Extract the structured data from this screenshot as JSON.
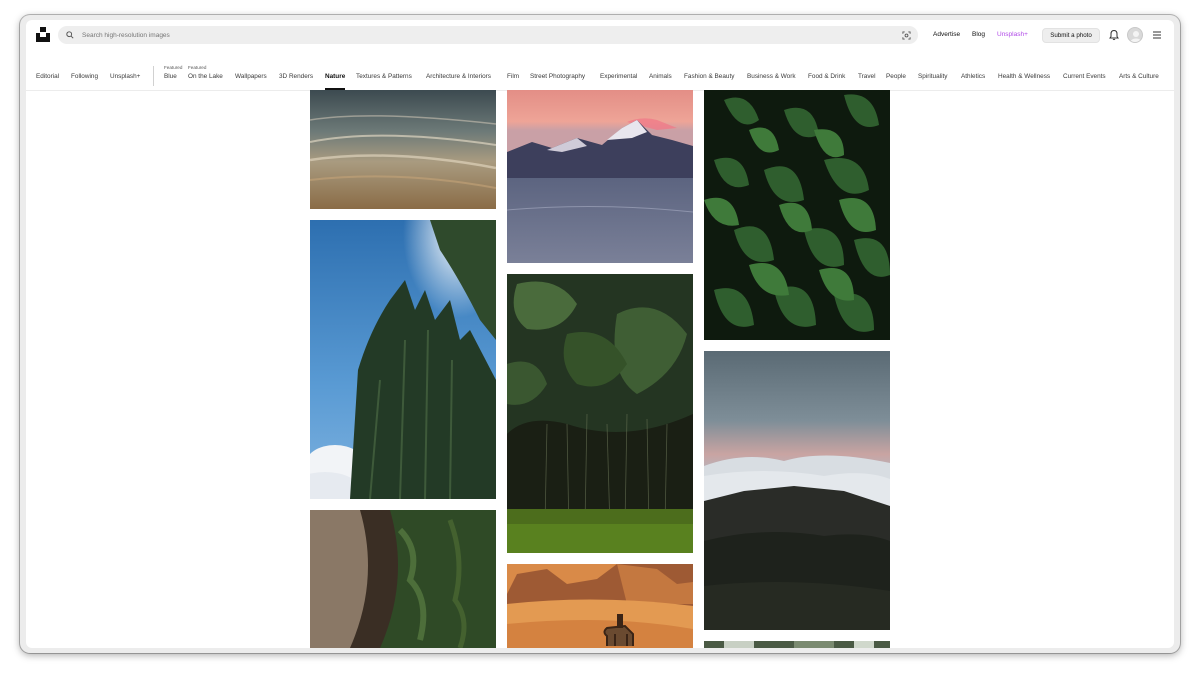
{
  "header": {
    "search_placeholder": "Search high-resolution images",
    "links": {
      "advertise": "Advertise",
      "blog": "Blog",
      "unsplash_plus": "Unsplash+"
    },
    "submit_label": "Submit a photo",
    "icons": {
      "logo": "unsplash-logo-icon",
      "search": "search-icon",
      "visual_search": "visual-search-icon",
      "notifications": "bell-icon",
      "menu": "hamburger-menu-icon"
    }
  },
  "categories": {
    "primary": [
      {
        "label": "Editorial"
      },
      {
        "label": "Following"
      },
      {
        "label": "Unsplash+"
      }
    ],
    "featured_tag": "Featured",
    "topics": [
      {
        "label": "Blue",
        "featured": true
      },
      {
        "label": "On the Lake",
        "featured": true
      },
      {
        "label": "Wallpapers"
      },
      {
        "label": "3D Renders"
      },
      {
        "label": "Nature",
        "active": true
      },
      {
        "label": "Textures & Patterns"
      },
      {
        "label": "Architecture & Interiors"
      },
      {
        "label": "Film"
      },
      {
        "label": "Street Photography"
      },
      {
        "label": "Experimental"
      },
      {
        "label": "Animals"
      },
      {
        "label": "Fashion & Beauty"
      },
      {
        "label": "Business & Work"
      },
      {
        "label": "Food & Drink"
      },
      {
        "label": "Travel"
      },
      {
        "label": "People"
      },
      {
        "label": "Spirituality"
      },
      {
        "label": "Athletics"
      },
      {
        "label": "Health & Wellness"
      },
      {
        "label": "Current Events"
      },
      {
        "label": "Arts & Culture"
      }
    ]
  },
  "photos": [
    {
      "subject": "beach-waves-photo"
    },
    {
      "subject": "cactus-sky-photo"
    },
    {
      "subject": "mossy-trunk-photo"
    },
    {
      "subject": "pink-mountain-lake-photo"
    },
    {
      "subject": "monstera-jungle-photo"
    },
    {
      "subject": "desert-camel-photo"
    },
    {
      "subject": "green-leaves-photo"
    },
    {
      "subject": "misty-hills-photo"
    },
    {
      "subject": "foliage-partial-photo"
    }
  ],
  "colors": {
    "accent_plus": "#b14ae8",
    "active_underline": "#111111"
  }
}
